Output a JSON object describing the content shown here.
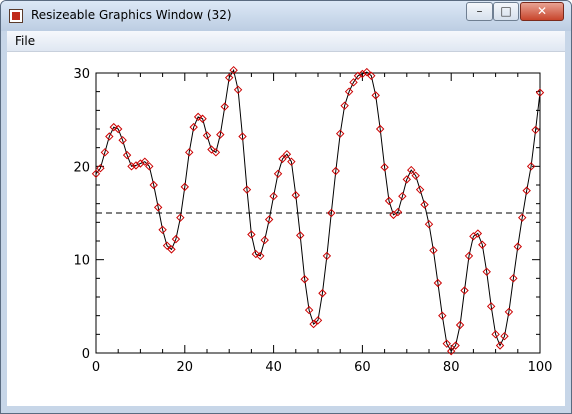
{
  "window": {
    "title": "Resizeable Graphics Window (32)"
  },
  "controls": {
    "minimize": "–",
    "maximize": "□",
    "close": "✕"
  },
  "menu": {
    "items": [
      {
        "label": "File"
      }
    ]
  },
  "chart_data": {
    "type": "line",
    "xlim": [
      0,
      100
    ],
    "ylim": [
      0,
      30
    ],
    "x_ticks": [
      0,
      20,
      40,
      60,
      80,
      100
    ],
    "y_ticks": [
      0,
      10,
      20,
      30
    ],
    "reference_line": {
      "y": 15,
      "style": "dashed"
    },
    "marker": "diamond",
    "marker_color": "#cc0000",
    "line_color": "#000000",
    "grid": false,
    "x": [
      0,
      1,
      2,
      3,
      4,
      5,
      6,
      7,
      8,
      9,
      10,
      11,
      12,
      13,
      14,
      15,
      16,
      17,
      18,
      19,
      20,
      21,
      22,
      23,
      24,
      25,
      26,
      27,
      28,
      29,
      30,
      31,
      32,
      33,
      34,
      35,
      36,
      37,
      38,
      39,
      40,
      41,
      42,
      43,
      44,
      45,
      46,
      47,
      48,
      49,
      50,
      51,
      52,
      53,
      54,
      55,
      56,
      57,
      58,
      59,
      60,
      61,
      62,
      63,
      64,
      65,
      66,
      67,
      68,
      69,
      70,
      71,
      72,
      73,
      74,
      75,
      76,
      77,
      78,
      79,
      80,
      81,
      82,
      83,
      84,
      85,
      86,
      87,
      88,
      89,
      90,
      91,
      92,
      93,
      94,
      95,
      96,
      97,
      98,
      99,
      100
    ],
    "y": [
      19.2,
      19.8,
      21.5,
      23.2,
      24.2,
      24.0,
      22.8,
      21.2,
      20.0,
      20.1,
      20.3,
      20.5,
      20.0,
      18.0,
      15.6,
      13.2,
      11.5,
      11.1,
      12.2,
      14.5,
      17.8,
      21.5,
      24.2,
      25.3,
      25.1,
      23.3,
      21.8,
      21.5,
      23.4,
      26.4,
      29.5,
      30.3,
      28.2,
      23.2,
      17.5,
      12.7,
      10.6,
      10.4,
      12.1,
      14.3,
      16.8,
      19.2,
      20.8,
      21.3,
      20.5,
      16.9,
      12.6,
      7.9,
      4.6,
      3.1,
      3.5,
      6.4,
      10.4,
      15.0,
      19.5,
      23.5,
      26.5,
      28.0,
      29.0,
      29.7,
      29.9,
      30.1,
      29.7,
      27.6,
      24.0,
      19.9,
      16.3,
      14.8,
      15.1,
      16.8,
      18.6,
      19.6,
      19.0,
      17.5,
      15.9,
      13.8,
      11.0,
      7.5,
      4.0,
      1.0,
      0.2,
      0.8,
      3.0,
      6.7,
      10.4,
      12.5,
      12.8,
      11.6,
      8.7,
      5.0,
      2.0,
      0.8,
      1.8,
      4.4,
      8.0,
      11.4,
      14.5,
      17.4,
      20.0,
      23.9,
      27.9
    ]
  }
}
